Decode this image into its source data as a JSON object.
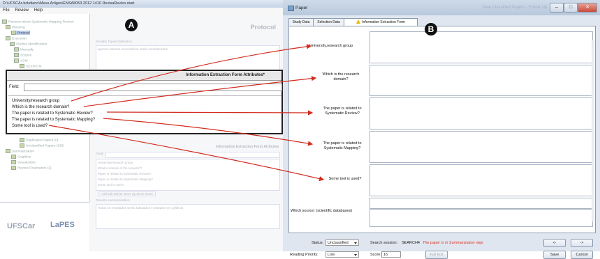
{
  "window_a": {
    "title": "D:\\UFSCAr-bckdiario\\Meus Artigos\\ENSA8053 2012 1410 RevisaReviso.start",
    "menu": [
      "File",
      "Review",
      "Help"
    ],
    "badge": "A",
    "tree": [
      "Revision about Systematic Mapping Review",
      "Planning",
      "Protocol",
      "Execution",
      "Studies Identification",
      "Manually",
      "Scopus",
      "ACM",
      "SEARCH4",
      "Duplicated Papers (0)",
      "Unclassified Papers (130)",
      "Summarization",
      "Graphics",
      "Visualization",
      "Review Finalization (2)"
    ],
    "protocol_label": "Protocol",
    "studies_type_label": "Studies Types Definition:",
    "studies_type_value": "apenas estudos secundários serão considerados",
    "ief_label": "Information Extraction Form Atributes",
    "field_label": "Field:",
    "faint_list": [
      "University/research group",
      "What is domain of the research?",
      "Paper is related to Systematic Review?",
      "Paper is related to Systematic Mapping?",
      "Some tool is used?"
    ],
    "faint_button": "Add  Edit  Delete  Move Up  Move Down",
    "results_label": "Results summarization:",
    "results_value": "Todos os resultados serão tabulados e plotados em gráficos",
    "logo1": "UFSCar",
    "logo2": "LaPES"
  },
  "attributes_dialog": {
    "title": "Information Extraction Form Attributes*",
    "field_label": "Field:",
    "items": [
      "University/research group",
      "Which is the research domain?",
      "The paper is related to Systematic Review?",
      "The paper is related to Systematic Mapping?",
      "Some tool is used?"
    ]
  },
  "window_b": {
    "title": "Paper",
    "background_title": "View Classified Papers - Follow Up",
    "badge": "B",
    "window_buttons": [
      "–",
      "□",
      "✕"
    ],
    "tabs": [
      "Study Data",
      "Selection Data",
      "Information Extraction Form"
    ],
    "questions": [
      "University,research group",
      "Which is the research domain?",
      "The paper is related to Systematic Review?",
      "The paper is related to Systematic Mapping?",
      "Some tool is used?"
    ],
    "which_source_label": "Which source: (scientific databases)",
    "status_label": "Status:",
    "status_value": "Unclassified",
    "reading_priority_label": "Reading Priority:",
    "reading_priority_value": "Low",
    "search_session_label": "Search session:",
    "search_session_value": "SEARCH4",
    "summarization_note": "The paper is in Summarization step",
    "score_label": "Score:",
    "score_value": "16",
    "full_text_button": "Full text",
    "prev_button": "<-",
    "next_button": "->",
    "save_button": "Save",
    "cancel_button": "Cancel"
  },
  "colors": {
    "arrow": "#d22b1e",
    "accent": "#b9cdea",
    "summarization_note": "#e03020"
  }
}
